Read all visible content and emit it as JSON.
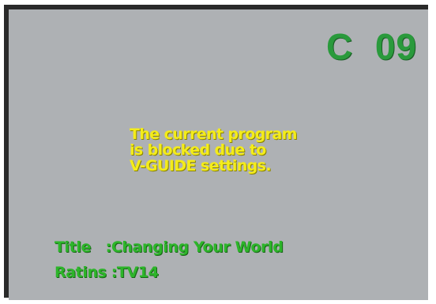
{
  "channel": "C  09",
  "blocked_message": {
    "line1": "The current program",
    "line2": "is blocked due to",
    "line3": "V-GUIDE settings."
  },
  "program_info": {
    "title_label": "Title",
    "title_value": ":Changing Your World",
    "rating_label": "Ratins",
    "rating_value": ":TV14"
  },
  "colors": {
    "screen_background": "#aeb1b4",
    "channel_text": "#2a9a3c",
    "message_text": "#f4ec1a",
    "info_text": "#2db52a"
  }
}
